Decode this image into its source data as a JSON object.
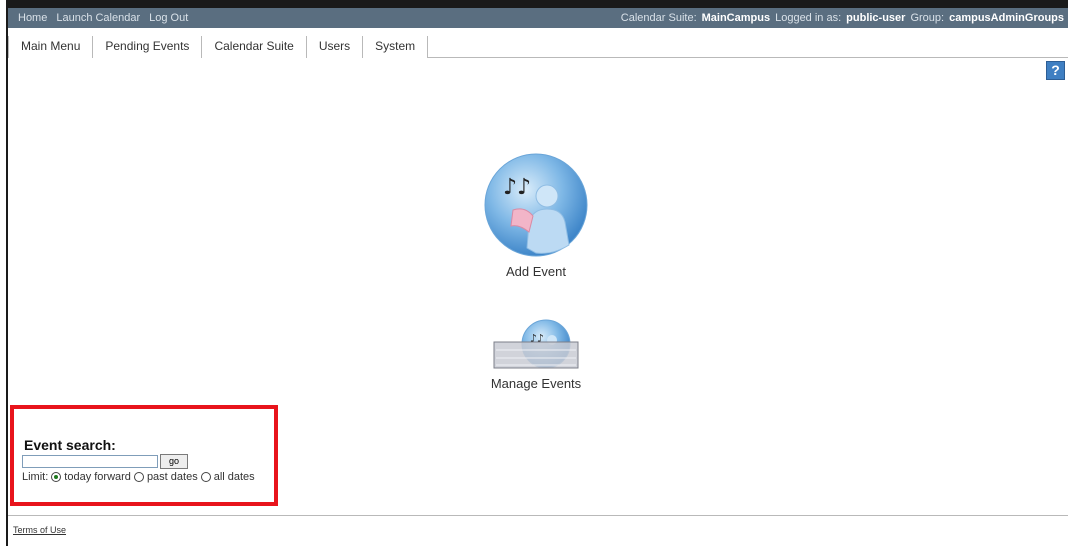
{
  "topbar": {
    "links": [
      "Home",
      "Launch Calendar",
      "Log Out"
    ],
    "suite_label": "Calendar Suite:",
    "suite_value": "MainCampus",
    "logged_label": "Logged in as:",
    "logged_value": "public-user",
    "group_label": "Group:",
    "group_value": "campusAdminGroups",
    "bg_color": "#5a6e80"
  },
  "tabs": [
    "Main Menu",
    "Pending Events",
    "Calendar Suite",
    "Users",
    "System"
  ],
  "help": {
    "icon": "help-icon",
    "label": "?"
  },
  "menu": {
    "add_event": {
      "label": "Add Event",
      "icon": "add-event-icon"
    },
    "manage_events": {
      "label": "Manage Events",
      "icon": "manage-events-icon"
    }
  },
  "search": {
    "title": "Event search:",
    "input_value": "",
    "go_label": "go",
    "limit_label": "Limit:",
    "options": [
      "today forward",
      "past dates",
      "all dates"
    ],
    "selected": "today forward",
    "highlight_color": "#e8141c"
  },
  "footer": {
    "terms": "Terms of Use"
  }
}
